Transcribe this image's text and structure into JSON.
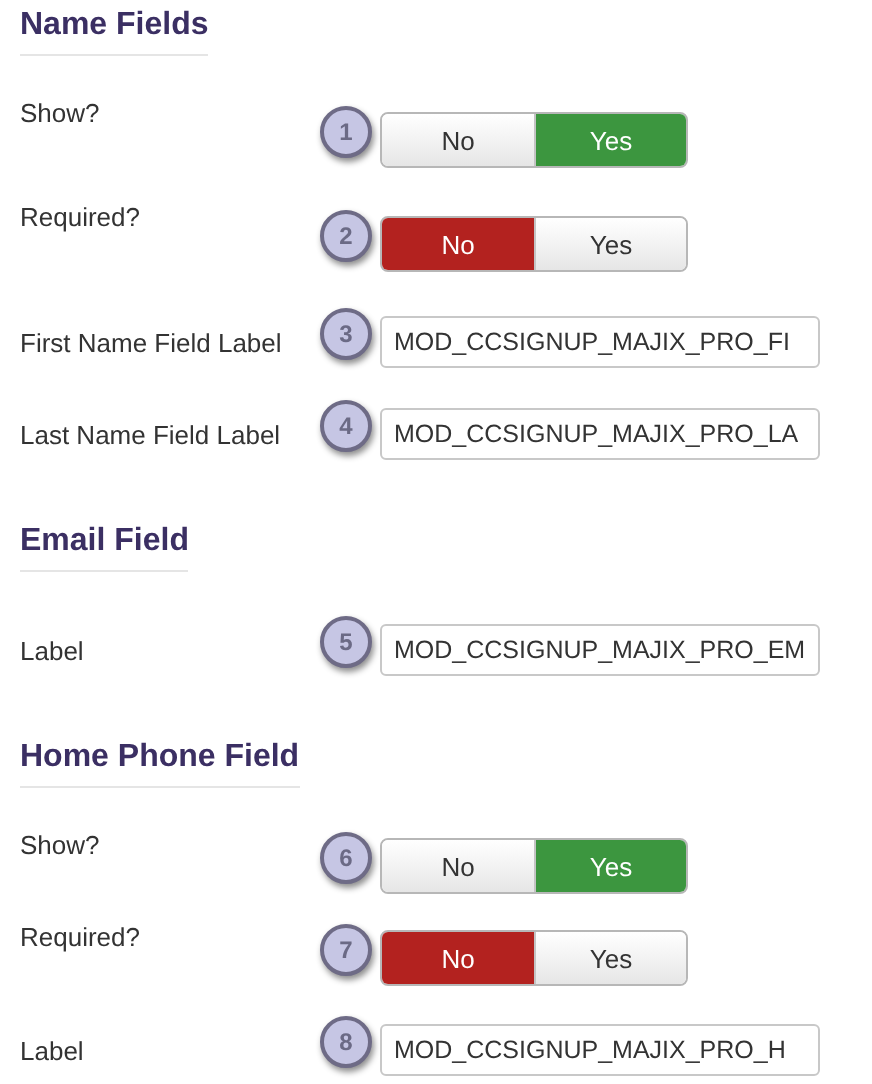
{
  "sections": [
    {
      "title": "Name Fields",
      "rows": [
        {
          "kind": "toggle",
          "label": "Show?",
          "step": "1",
          "options": [
            {
              "label": "No",
              "kind": "negative",
              "selected": false
            },
            {
              "label": "Yes",
              "kind": "positive",
              "selected": true
            }
          ]
        },
        {
          "kind": "toggle",
          "label": "Required?",
          "step": "2",
          "options": [
            {
              "label": "No",
              "kind": "negative",
              "selected": true
            },
            {
              "label": "Yes",
              "kind": "positive",
              "selected": false
            }
          ]
        },
        {
          "kind": "text",
          "label": "First Name Field Label",
          "step": "3",
          "value": "MOD_CCSIGNUP_MAJIX_PRO_FI"
        },
        {
          "kind": "text",
          "label": "Last Name Field Label",
          "step": "4",
          "value": "MOD_CCSIGNUP_MAJIX_PRO_LA"
        }
      ]
    },
    {
      "title": "Email Field",
      "rows": [
        {
          "kind": "text",
          "label": "Label",
          "step": "5",
          "value": "MOD_CCSIGNUP_MAJIX_PRO_EM"
        }
      ]
    },
    {
      "title": "Home Phone Field",
      "rows": [
        {
          "kind": "toggle",
          "label": "Show?",
          "step": "6",
          "options": [
            {
              "label": "No",
              "kind": "negative",
              "selected": false
            },
            {
              "label": "Yes",
              "kind": "positive",
              "selected": true
            }
          ]
        },
        {
          "kind": "toggle",
          "label": "Required?",
          "step": "7",
          "options": [
            {
              "label": "No",
              "kind": "negative",
              "selected": true
            },
            {
              "label": "Yes",
              "kind": "positive",
              "selected": false
            }
          ]
        },
        {
          "kind": "text",
          "label": "Label",
          "step": "8",
          "value": "MOD_CCSIGNUP_MAJIX_PRO_H"
        }
      ]
    }
  ]
}
